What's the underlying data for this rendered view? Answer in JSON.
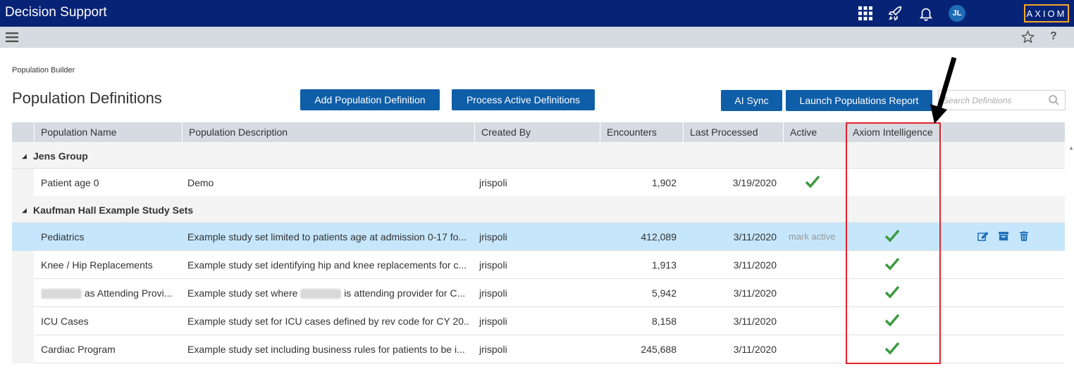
{
  "app": {
    "title": "Decision Support",
    "logo_text": "AXIOM",
    "avatar_initials": "JL"
  },
  "breadcrumb": "Population Builder",
  "page_title": "Population Definitions",
  "buttons": {
    "add": "Add Population Definition",
    "process": "Process Active Definitions",
    "ai_sync": "AI Sync",
    "launch_report": "Launch Populations Report"
  },
  "search": {
    "placeholder": "Search Definitions"
  },
  "columns": [
    "Population Name",
    "Population Description",
    "Created By",
    "Encounters",
    "Last Processed",
    "Active",
    "Axiom Intelligence"
  ],
  "groups": [
    {
      "label": "Jens Group",
      "rows": [
        {
          "name": "Patient age 0",
          "description": "Demo",
          "created_by": "jrispoli",
          "encounters": "1,902",
          "last_processed": "3/19/2020",
          "active": true,
          "ai": false
        }
      ]
    },
    {
      "label": "Kaufman Hall Example Study Sets",
      "rows": [
        {
          "name": "Pediatrics",
          "description": "Example study set limited to patients age at admission 0-17 fo...",
          "created_by": "jrispoli",
          "encounters": "412,089",
          "last_processed": "3/11/2020",
          "active_text": "mark active",
          "ai": true,
          "selected": true
        },
        {
          "name": "Knee / Hip Replacements",
          "description": "Example study set identifying hip and knee replacements for c...",
          "created_by": "jrispoli",
          "encounters": "1,913",
          "last_processed": "3/11/2020",
          "ai": true
        },
        {
          "name": "as Attending Provi...",
          "description_pre": "Example study set where",
          "description_post": "is attending provider for C...",
          "created_by": "jrispoli",
          "encounters": "5,942",
          "last_processed": "3/11/2020",
          "ai": true
        },
        {
          "name": "ICU Cases",
          "description": "Example study set for ICU cases defined by rev code for CY 20...",
          "created_by": "jrispoli",
          "encounters": "8,158",
          "last_processed": "3/11/2020",
          "ai": true
        },
        {
          "name": "Cardiac Program",
          "description": "Example study set including business rules for patients to be i...",
          "created_by": "jrispoli",
          "encounters": "245,688",
          "last_processed": "3/11/2020",
          "ai": true
        }
      ]
    }
  ],
  "colors": {
    "topbar": "#072376",
    "button": "#0f5ea8",
    "check": "#3d9a3f",
    "highlight": "#e4222c",
    "selected_row": "#c6e6fb"
  }
}
